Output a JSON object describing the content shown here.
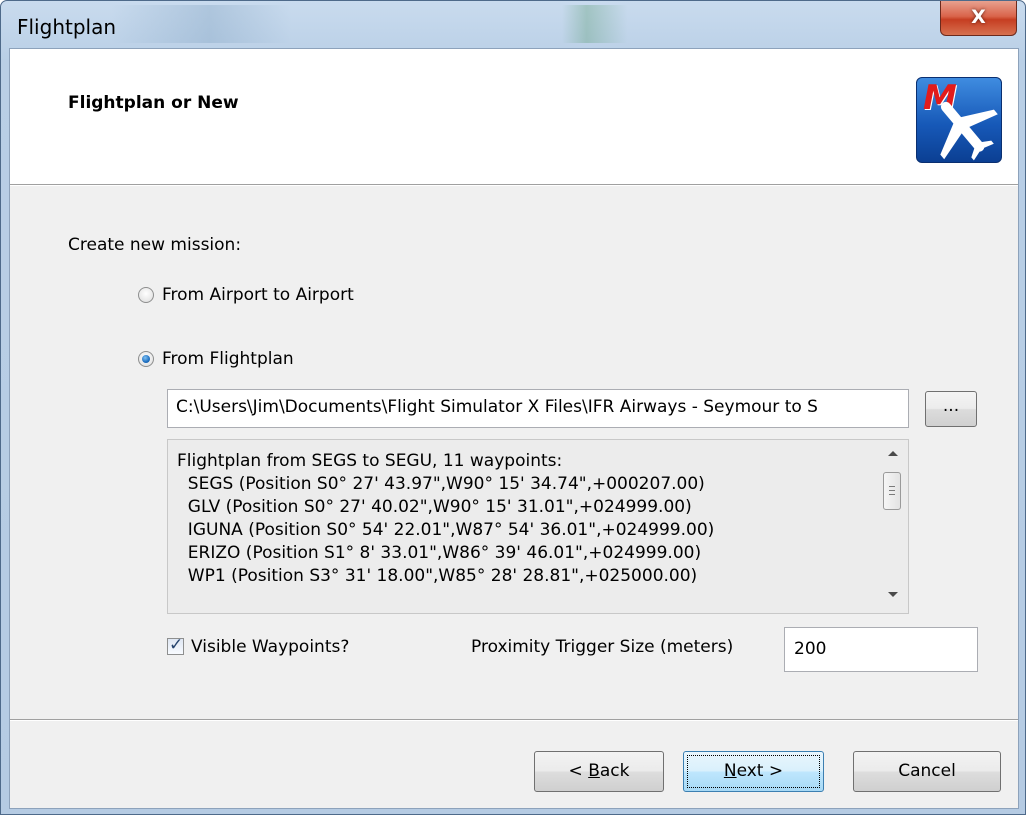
{
  "window": {
    "title": "Flightplan",
    "close_glyph": "X"
  },
  "header": {
    "title": "Flightplan or New",
    "logo_letter": "M"
  },
  "content": {
    "create_label": "Create new mission:",
    "radio_airport": {
      "label": "From Airport to Airport",
      "checked": false
    },
    "radio_flightplan": {
      "label": "From Flightplan",
      "checked": true
    },
    "path_value": "C:\\Users\\Jim\\Documents\\Flight Simulator X Files\\IFR Airways - Seymour to S",
    "browse_label": "...",
    "waypoint_lines": [
      "Flightplan from SEGS to SEGU, 11 waypoints:",
      "  SEGS (Position S0° 27' 43.97\",W90° 15' 34.74\",+000207.00)",
      "  GLV (Position S0° 27' 40.02\",W90° 15' 31.01\",+024999.00)",
      "  IGUNA (Position S0° 54' 22.01\",W87° 54' 36.01\",+024999.00)",
      "  ERIZO (Position S1° 8' 33.01\",W86° 39' 46.01\",+024999.00)",
      "  WP1 (Position S3° 31' 18.00\",W85° 28' 28.81\",+025000.00)"
    ],
    "visible_waypoints": {
      "label": "Visible Waypoints?",
      "checked": true
    },
    "proximity": {
      "label": "Proximity Trigger Size (meters)",
      "value": "200"
    }
  },
  "buttons": {
    "back_prefix": "< ",
    "back_accel": "B",
    "back_rest": "ack",
    "next_accel": "N",
    "next_rest": "ext >",
    "cancel": "Cancel"
  },
  "icons": [
    "close-icon",
    "app-logo-icon",
    "ellipsis-icon",
    "scroll-up-icon",
    "scroll-down-icon",
    "checkmark-icon"
  ]
}
